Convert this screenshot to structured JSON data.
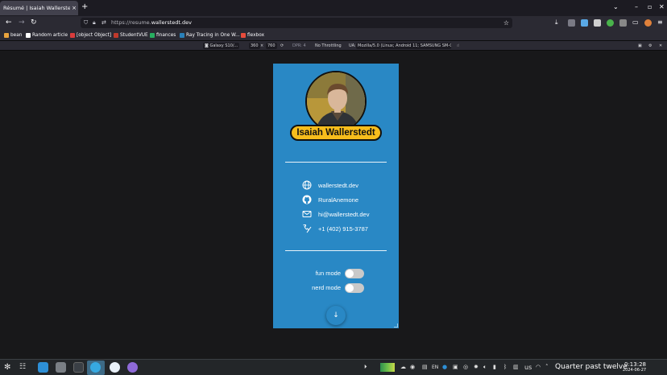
{
  "browser": {
    "tab_title": "Résumé | Isaiah Wallerstedt",
    "tab_close": "×",
    "new_tab": "+",
    "url_prefix": "https://resume.",
    "url_domain": "wallerstedt.dev",
    "bookmarks": [
      {
        "label": "bean",
        "color": "#e8a33d"
      },
      {
        "label": "Random article",
        "color": "#ffffff"
      },
      {
        "label": "[object Object]",
        "color": "#d93c3c"
      },
      {
        "label": "StudentVUE",
        "color": "#c0392b"
      },
      {
        "label": "finances",
        "color": "#27ae60"
      },
      {
        "label": "Ray Tracing in One W...",
        "color": "#2980b9"
      },
      {
        "label": "flexbox",
        "color": "#e74c3c"
      }
    ]
  },
  "devtools": {
    "device": "Galaxy S10/...",
    "width": "360",
    "height": "760",
    "dpr": "DPR: 4",
    "throttling": "No Throttling",
    "ua_label": "UA:",
    "user_agent": "Mozilla/5.0 (Linux; Android 11; SAMSUNG SM-G"
  },
  "resume": {
    "name": "Isaiah Wallerstedt",
    "contacts": [
      {
        "icon": "globe-icon",
        "text": "wallerstedt.dev"
      },
      {
        "icon": "github-icon",
        "text": "RuralAnemone"
      },
      {
        "icon": "mail-icon",
        "text": "hi@wallerstedt.dev"
      },
      {
        "icon": "phone-icon",
        "text": "+1 (402) 915-3787"
      }
    ],
    "toggles": [
      {
        "label": "fun mode",
        "on": false
      },
      {
        "label": "nerd mode",
        "on": false
      }
    ],
    "scroll_arrow": "↓",
    "accent_color": "#2988c5",
    "badge_color": "#f6bd1c"
  },
  "taskbar": {
    "lang": "EN",
    "keyboard": "us",
    "status_text": "Quarter past twelve",
    "time": "0:13:28",
    "date": "2024-06-27"
  }
}
